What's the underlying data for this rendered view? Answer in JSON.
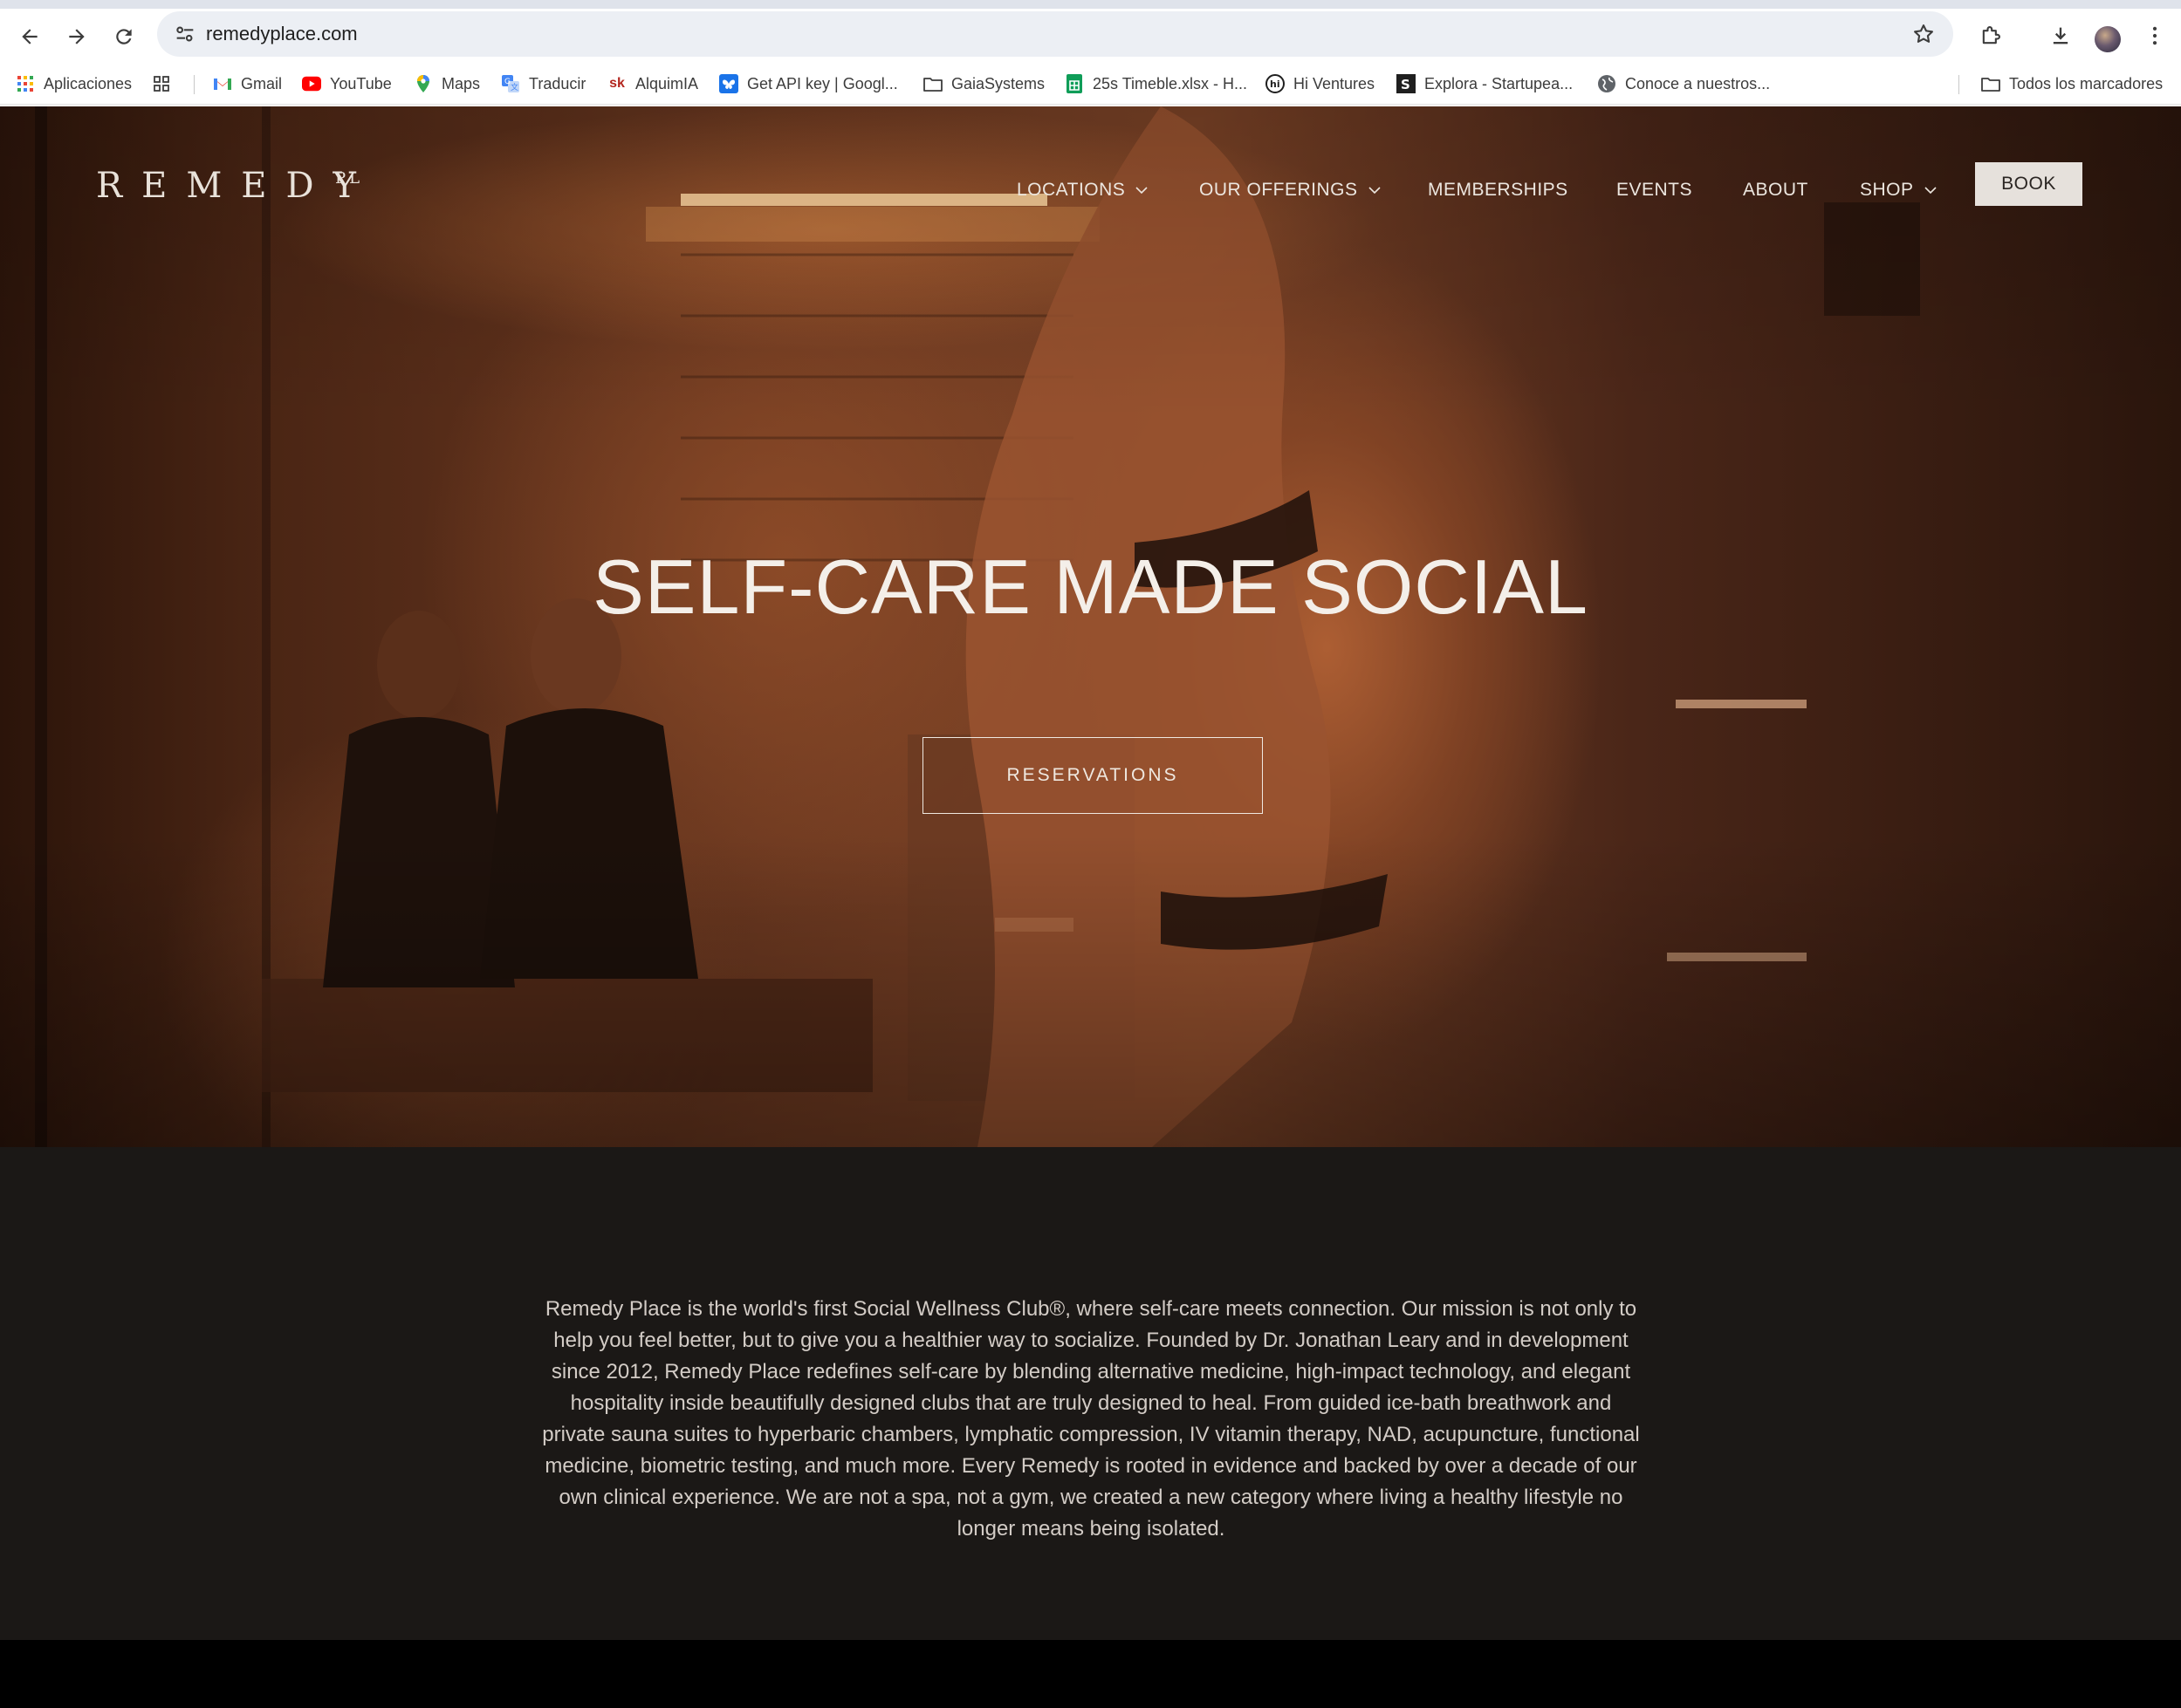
{
  "browser": {
    "url": "remedyplace.com",
    "bookmarks": [
      {
        "label": "Aplicaciones",
        "icon": "apps-grid-icon"
      },
      {
        "label": "",
        "icon": "tab-groups-icon"
      },
      {
        "label": "Gmail",
        "icon": "gmail-icon"
      },
      {
        "label": "YouTube",
        "icon": "youtube-icon"
      },
      {
        "label": "Maps",
        "icon": "maps-icon"
      },
      {
        "label": "Traducir",
        "icon": "translate-icon"
      },
      {
        "label": "AlquimIA",
        "icon": "sk-icon"
      },
      {
        "label": "Get API key | Googl...",
        "icon": "butterfly-icon"
      },
      {
        "label": "GaiaSystems",
        "icon": "folder-icon"
      },
      {
        "label": "25s Timeble.xlsx - H...",
        "icon": "sheets-icon"
      },
      {
        "label": "Hi Ventures",
        "icon": "hi-icon"
      },
      {
        "label": "Explora - Startupea...",
        "icon": "s-icon"
      },
      {
        "label": "Conoce a nuestros...",
        "icon": "globe-icon"
      }
    ],
    "all_bookmarks_label": "Todos los marcadores",
    "colors": {
      "omnibox": "#eceff4",
      "chrome": "#ffffff"
    }
  },
  "site": {
    "logo": "REMEDY",
    "logo_sup": "PL",
    "nav": [
      {
        "label": "LOCATIONS",
        "has_dropdown": true
      },
      {
        "label": "OUR OFFERINGS",
        "has_dropdown": true
      },
      {
        "label": "MEMBERSHIPS",
        "has_dropdown": false
      },
      {
        "label": "EVENTS",
        "has_dropdown": false
      },
      {
        "label": "ABOUT",
        "has_dropdown": false
      },
      {
        "label": "SHOP",
        "has_dropdown": true
      }
    ],
    "book_label": "BOOK",
    "hero": {
      "title": "SELF-CARE MADE SOCIAL",
      "cta_label": "RESERVATIONS"
    },
    "about_text": "Remedy Place is the world's first Social Wellness Club®, where self-care meets connection. Our mission is not only to help you feel better, but to give you a healthier way to socialize. Founded by Dr. Jonathan Leary and in development since 2012, Remedy Place redefines self-care by blending alternative medicine, high-impact technology, and elegant hospitality inside beautifully designed clubs that are truly designed to heal. From guided ice-bath breathwork and private sauna suites to hyperbaric chambers, lymphatic compression, IV vitamin therapy, NAD, acupuncture, functional medicine, biometric testing, and much more. Every Remedy is rooted in evidence and backed by over a decade of our own clinical experience. We are not a spa, not a gym, we created a new category where living a healthy lifestyle no longer means being isolated.",
    "colors": {
      "about_bg": "#1b1816",
      "hero_text": "#f4efe9",
      "book_bg": "#e6e1dc"
    }
  }
}
